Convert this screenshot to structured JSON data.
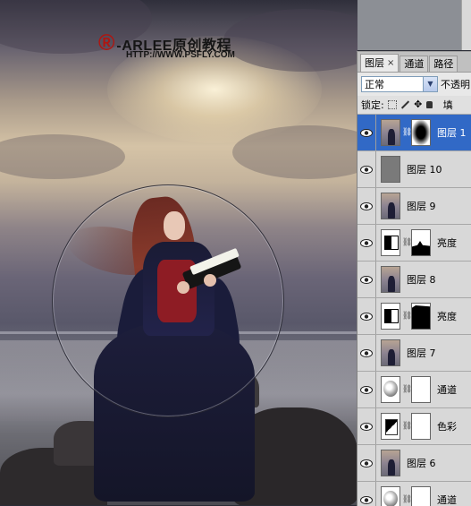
{
  "watermark": {
    "mark": "®",
    "brand": "-ARLEE原创教程",
    "url": "HTTP://WWW.PSFLY.COM"
  },
  "panel": {
    "tabs": [
      {
        "label": "图层",
        "close": "×",
        "active": true
      },
      {
        "label": "通道",
        "active": false
      },
      {
        "label": "路径",
        "active": false
      }
    ],
    "blend_mode": "正常",
    "opacity_label": "不透明",
    "lock_label": "锁定:",
    "fill_label": "填",
    "layers": [
      {
        "name": "图层 1",
        "thumb": "photo",
        "mask": "radial",
        "selected": true
      },
      {
        "name": "图层 10",
        "thumb": "gray",
        "mask": null,
        "selected": false
      },
      {
        "name": "图层 9",
        "thumb": "photo",
        "mask": null,
        "selected": false
      },
      {
        "name": "亮度",
        "thumb": "levels",
        "mask": "shape1",
        "selected": false
      },
      {
        "name": "图层 8",
        "thumb": "photo",
        "mask": null,
        "selected": false
      },
      {
        "name": "亮度",
        "thumb": "levels",
        "mask": "shape2",
        "selected": false
      },
      {
        "name": "图层 7",
        "thumb": "photo",
        "mask": null,
        "selected": false
      },
      {
        "name": "通道",
        "thumb": "curves",
        "mask": "white",
        "selected": false
      },
      {
        "name": "色彩",
        "thumb": "hue",
        "mask": "white",
        "selected": false
      },
      {
        "name": "图层 6",
        "thumb": "photo",
        "mask": null,
        "selected": false
      },
      {
        "name": "通道",
        "thumb": "curves",
        "mask": "white",
        "selected": false
      }
    ]
  }
}
